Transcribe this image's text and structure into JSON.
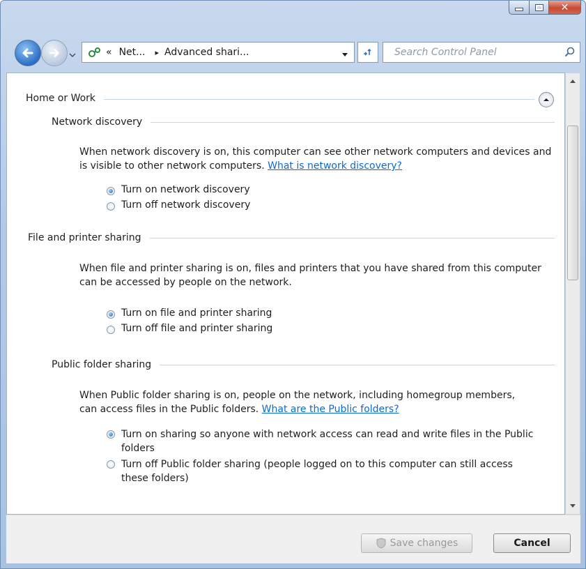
{
  "window": {
    "caption": {
      "minimize_icon": "minimize-icon",
      "maximize_icon": "maximize-icon",
      "close_icon": "close-icon"
    }
  },
  "address": {
    "crumbs": [
      "Net...",
      "Advanced shari..."
    ],
    "overflow": "«",
    "separator": "▸",
    "search_placeholder": "Search Control Panel"
  },
  "section": {
    "title": "Home or Work",
    "groups": [
      {
        "title": "Network discovery",
        "description": "When network discovery is on, this computer can see other network computers and devices and is visible to other network computers.",
        "link": "What is network discovery?",
        "options": [
          {
            "label": "Turn on network discovery",
            "selected": true
          },
          {
            "label": "Turn off network discovery",
            "selected": false
          }
        ]
      },
      {
        "title": "File and printer sharing",
        "description": "When file and printer sharing is on, files and printers that you have shared from this computer can be accessed by people on the network.",
        "link": "",
        "options": [
          {
            "label": "Turn on file and printer sharing",
            "selected": true
          },
          {
            "label": "Turn off file and printer sharing",
            "selected": false
          }
        ]
      },
      {
        "title": "Public folder sharing",
        "description": "When Public folder sharing is on, people on the network, including homegroup members, can access files in the Public folders.",
        "link": "What are the Public folders?",
        "options": [
          {
            "label": "Turn on sharing so anyone with network access can read and write files in the Public folders",
            "selected": true
          },
          {
            "label": "Turn off Public folder sharing (people logged on to this computer can still access these folders)",
            "selected": false
          }
        ]
      }
    ]
  },
  "footer": {
    "save_label": "Save changes",
    "cancel_label": "Cancel"
  }
}
